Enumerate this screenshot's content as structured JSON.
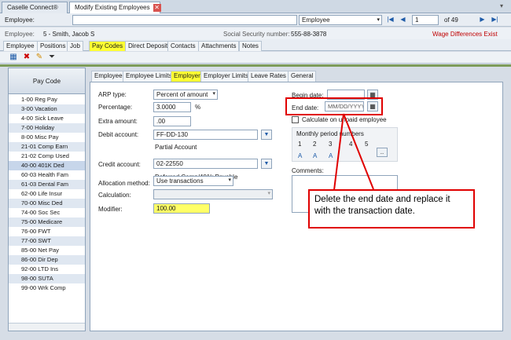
{
  "tabs": [
    {
      "label": "Caselle Connect®",
      "active": false
    },
    {
      "label": "Modify Existing Employees",
      "active": true
    }
  ],
  "employee_bar": {
    "label": "Employee:",
    "search_by": "Employee",
    "record": "1",
    "of_total": "of 49"
  },
  "info": {
    "employee_label": "Employee:",
    "employee_value": "5 - Smith, Jacob S",
    "ssn_label": "Social Security number:",
    "ssn_value": "555-88-3878",
    "warning": "Wage Differences Exist"
  },
  "main_tabs": [
    "Employee",
    "Positions",
    "Job",
    "Pay Codes",
    "Direct Deposit",
    "Contacts",
    "Attachments",
    "Notes"
  ],
  "active_main_tab": "Pay Codes",
  "pay_codes": {
    "header": "Pay Code",
    "items": [
      "1-00 Reg Pay",
      "3-00 Vacation",
      "4-00 Sick Leave",
      "7-00 Holiday",
      "8-00 Misc Pay",
      "21-01 Comp Earn",
      "21-02 Comp Used",
      "40-00 401K Ded",
      "60-03 Health Fam",
      "61-03 Dental Fam",
      "62-00 Life Insur",
      "70-00 Misc Ded",
      "74-00 Soc Sec",
      "75-00 Medicare",
      "76-00 FWT",
      "77-00 SWT",
      "85-00 Net Pay",
      "86-00 Dir Dep",
      "92-00 LTD Ins",
      "98-00 SUTA",
      "99-00 Wrk Comp"
    ],
    "selected": "40-00 401K Ded"
  },
  "sub_tabs": [
    "Employee",
    "Employee Limits",
    "Employer",
    "Employer Limits",
    "Leave Rates",
    "General"
  ],
  "active_sub_tab": "Employer",
  "form": {
    "arp_type_label": "ARP type:",
    "arp_type": "Percent of amount",
    "percentage_label": "Percentage:",
    "percentage": "3.0000",
    "percent_sign": "%",
    "extra_amount_label": "Extra amount:",
    "extra_amount": ".00",
    "debit_label": "Debit account:",
    "debit": "FF-DD-130",
    "debit_desc": "Partial Account",
    "credit_label": "Credit account:",
    "credit": "02-22550",
    "credit_desc": "Deferred Comp/401k Payable",
    "allocation_label": "Allocation method:",
    "allocation": "Use transactions",
    "calculation_label": "Calculation:",
    "calculation": "",
    "modifier_label": "Modifier:",
    "modifier": "100.00",
    "begin_label": "Begin date:",
    "begin": "",
    "end_label": "End date:",
    "end_placeholder": "MM/DD/YYYY",
    "unpaid_label": "Calculate on unpaid employee",
    "monthly_label": "Monthly period numbers",
    "periods": [
      "1",
      "2",
      "3",
      "4",
      "5"
    ],
    "period_values": [
      "A",
      "A",
      "A",
      "",
      ""
    ],
    "more_button": "..",
    "comments_label": "Comments:"
  },
  "callout": "Delete the end date and replace it with the transaction date.",
  "colors": {
    "highlight": "#ffff33",
    "annotation": "#e00000",
    "warning": "#c00000"
  }
}
